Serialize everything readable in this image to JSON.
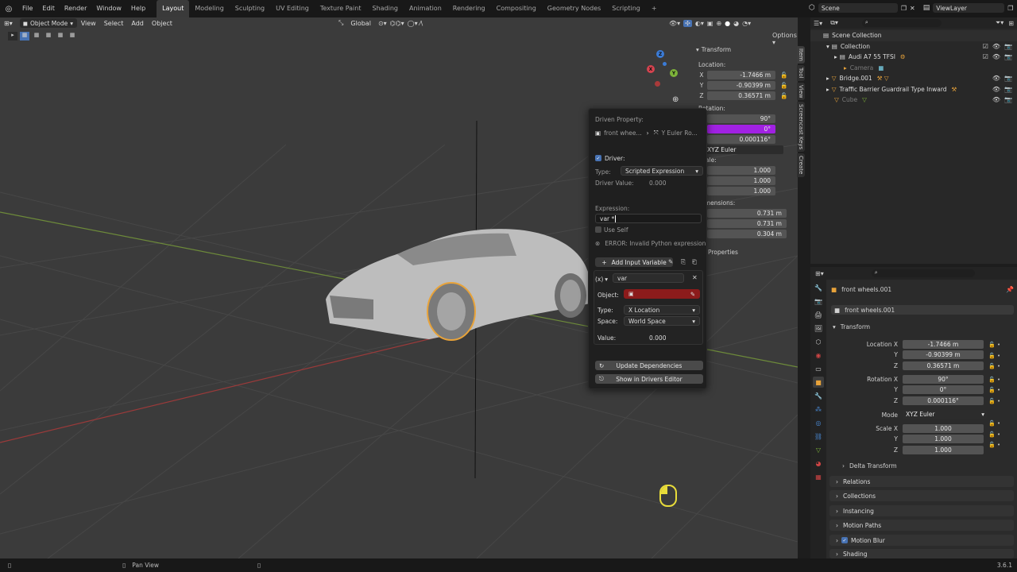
{
  "app": {
    "version": "3.6.1"
  },
  "menu": [
    "File",
    "Edit",
    "Render",
    "Window",
    "Help"
  ],
  "workspaces": [
    {
      "label": "Layout",
      "active": true
    },
    {
      "label": "Modeling"
    },
    {
      "label": "Sculpting"
    },
    {
      "label": "UV Editing"
    },
    {
      "label": "Texture Paint"
    },
    {
      "label": "Shading"
    },
    {
      "label": "Animation"
    },
    {
      "label": "Rendering"
    },
    {
      "label": "Compositing"
    },
    {
      "label": "Geometry Nodes"
    },
    {
      "label": "Scripting"
    }
  ],
  "add_workspace": "+",
  "scene": {
    "label": "Scene",
    "view_layer": "ViewLayer"
  },
  "viewport_header": {
    "mode": "Object Mode",
    "menus": [
      "View",
      "Select",
      "Add",
      "Object"
    ],
    "orientation": "Global",
    "options": "Options"
  },
  "npanel": {
    "title": "Transform",
    "location_label": "Location:",
    "location": [
      "-1.7466 m",
      "-0.90399 m",
      "0.36571 m"
    ],
    "rotation_label": "Rotation:",
    "rotation": [
      "90°",
      "0°",
      "0.000116°"
    ],
    "rotation_mode": "XYZ Euler",
    "scale_label": "Scale:",
    "scale": [
      "1.000",
      "1.000",
      "1.000"
    ],
    "dimensions_label": "Dimensions:",
    "dimensions": [
      "0.731 m",
      "0.731 m",
      "0.304 m"
    ],
    "properties": "Properties",
    "axes": [
      "X",
      "Y",
      "Z"
    ]
  },
  "sidebar_tabs": [
    "Item",
    "Tool",
    "View",
    "Screencast Keys",
    "Create"
  ],
  "driver_popup": {
    "driven_property": "Driven Property:",
    "object_path": "front whee...",
    "property_path": "Y Euler Ro...",
    "driver_label": "Driver:",
    "type_label": "Type:",
    "type_value": "Scripted Expression",
    "driver_value_label": "Driver Value:",
    "driver_value": "0.000",
    "expression_label": "Expression:",
    "expression_value": "var *",
    "use_self": "Use Self",
    "error": "ERROR: Invalid Python expression",
    "add_variable": "Add Input Variable",
    "var_type": "(x)",
    "var_name": "var",
    "object_label": "Object:",
    "var_type_label": "Type:",
    "var_type_value": "X Location",
    "space_label": "Space:",
    "space_value": "World Space",
    "value_label": "Value:",
    "value": "0.000",
    "update_deps": "Update Dependencies",
    "show_editor": "Show in Drivers Editor"
  },
  "outliner": {
    "root": "Scene Collection",
    "items": [
      {
        "label": "Collection",
        "indent": 1
      },
      {
        "label": "Audi A7 55 TFSI",
        "indent": 2
      },
      {
        "label": "Camera",
        "indent": 2,
        "dim": true
      },
      {
        "label": "Bridge.001",
        "indent": 1
      },
      {
        "label": "Traffic Barrier Guardrail Type Inward",
        "indent": 1
      },
      {
        "label": "Cube",
        "indent": 1,
        "dim": true
      }
    ]
  },
  "properties": {
    "object": "front wheels.001",
    "object_field": "front wheels.001",
    "transform": "Transform",
    "location_x_label": "Location X",
    "y_label": "Y",
    "z_label": "Z",
    "location": [
      "-1.7466 m",
      "-0.90399 m",
      "0.36571 m"
    ],
    "rotation_x_label": "Rotation X",
    "rotation": [
      "90°",
      "0°",
      "0.000116°"
    ],
    "mode_label": "Mode",
    "mode_value": "XYZ Euler",
    "scale_x_label": "Scale X",
    "scale": [
      "1.000",
      "1.000",
      "1.000"
    ],
    "delta_transform": "Delta Transform",
    "sections": [
      "Relations",
      "Collections",
      "Instancing",
      "Motion Paths",
      "Motion Blur",
      "Shading"
    ]
  },
  "status": {
    "pan_view": "Pan View"
  },
  "colors": {
    "accent": "#4772b3",
    "selection": "#e8a33a",
    "highlight": "#a121e3",
    "error_red": "#8c1b1b"
  }
}
